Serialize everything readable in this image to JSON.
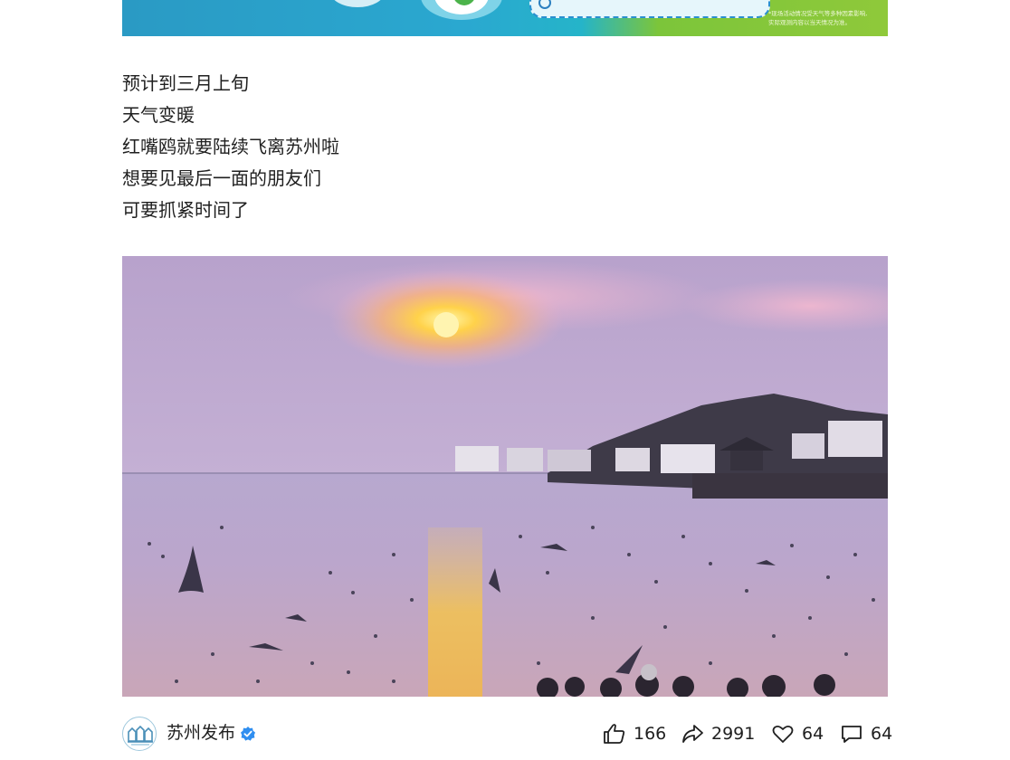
{
  "banner": {
    "note_line1": "*现场活动情况受天气等多种因素影响,",
    "note_line2": "实际观测内容以当天情况为准。"
  },
  "article": {
    "lines": [
      "预计到三月上旬",
      "天气变暖",
      "红嘴鸥就要陆续飞离苏州啦",
      "想要见最后一面的朋友们",
      "可要抓紧时间了"
    ]
  },
  "photo": {
    "subject": "sunset over lake with flying red-billed gulls and a village on a peninsula"
  },
  "footer": {
    "author": "苏州发布",
    "verified_icon": "verified-check-icon",
    "like_icon": "thumbs-up-icon",
    "like_count": "166",
    "share_icon": "share-arrow-icon",
    "share_count": "2991",
    "favorite_icon": "heart-icon",
    "favorite_count": "64",
    "comment_icon": "comment-bubble-icon",
    "comment_count": "64",
    "verified_color": "#2f8ef0"
  }
}
